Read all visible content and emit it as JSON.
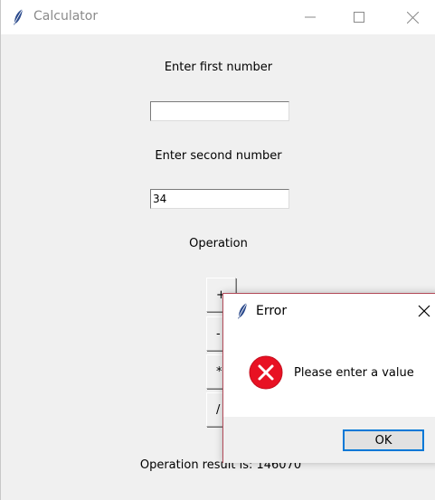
{
  "window": {
    "title": "Calculator",
    "icon": "feather-icon",
    "controls": [
      "minimize-icon",
      "maximize-icon",
      "close-icon"
    ]
  },
  "form": {
    "first_label": "Enter first number",
    "first_value": "",
    "second_label": "Enter second number",
    "second_value": "34",
    "operation_label": "Operation",
    "operations": [
      "+",
      "-",
      "*",
      "/"
    ],
    "result_text": "Operation result is: 146070"
  },
  "dialog": {
    "title": "Error",
    "message": "Please enter a value",
    "ok_label": "OK",
    "icon": "error-icon"
  },
  "colors": {
    "background": "#f0f0f0",
    "dialog_border": "#b34b5a",
    "error_red": "#e81123",
    "focus_blue": "#0078d7"
  }
}
